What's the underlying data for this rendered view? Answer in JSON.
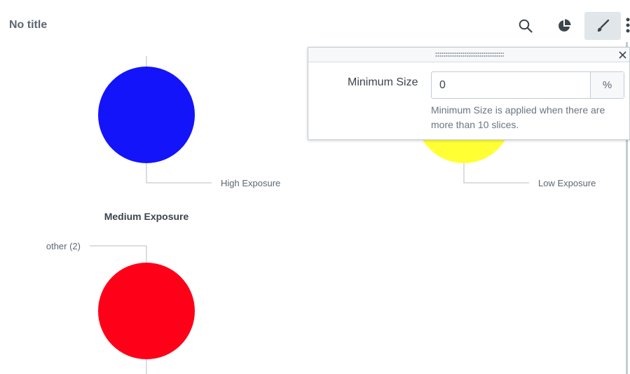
{
  "header": {
    "title": "No title"
  },
  "toolbar": {
    "search": "search-icon",
    "chart_type": "pie-chart-icon",
    "format": "paintbrush-icon",
    "more": "kebab-menu-icon"
  },
  "chart_data": {
    "type": "pie",
    "charts": [
      {
        "slices": [
          {
            "label": "High Exposure",
            "share": 100,
            "color": "#1414fa"
          }
        ]
      },
      {
        "slices": [
          {
            "label": "Low Exposure",
            "share": 100,
            "color": "#ffff33"
          }
        ]
      },
      {
        "title": "Medium Exposure",
        "slices": [
          {
            "label": "other (2)",
            "share": 100,
            "color": "#ff0019"
          }
        ]
      }
    ]
  },
  "format_panel": {
    "field_label": "Minimum Size",
    "field_value": "0",
    "field_unit": "%",
    "help_text": "Minimum Size is applied when there are more than 10 slices."
  }
}
